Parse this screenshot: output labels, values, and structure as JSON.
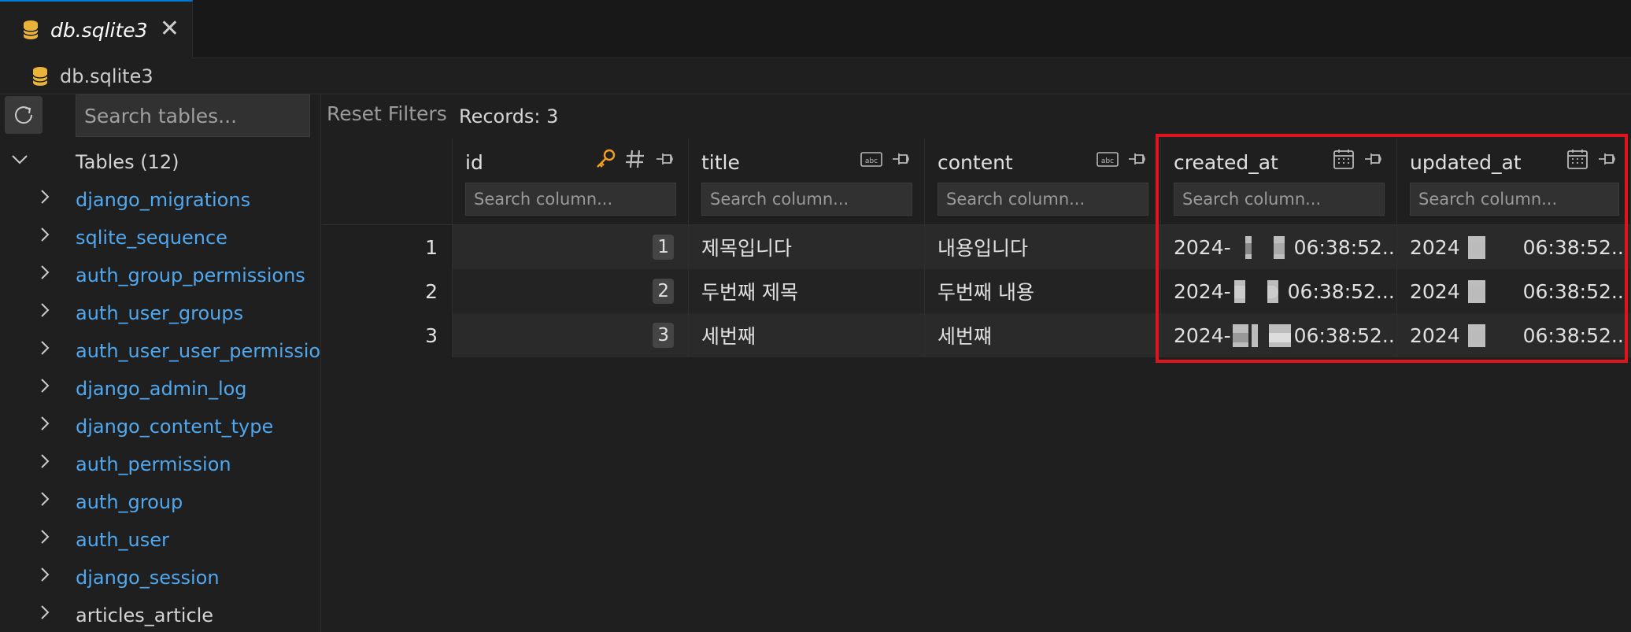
{
  "tab": {
    "title": "db.sqlite3",
    "close_glyph": "✕"
  },
  "breadcrumb": {
    "label": "db.sqlite3"
  },
  "sidebar": {
    "search_placeholder": "Search tables...",
    "tables_header": "Tables (12)",
    "tables": [
      "django_migrations",
      "sqlite_sequence",
      "auth_group_permissions",
      "auth_user_groups",
      "auth_user_user_permissions",
      "django_admin_log",
      "django_content_type",
      "auth_permission",
      "auth_group",
      "auth_user",
      "django_session",
      "articles_article"
    ]
  },
  "toolbar": {
    "reset_label": "Reset Filters",
    "records_label": "Records: 3"
  },
  "columns": [
    {
      "name": "id",
      "placeholder": "Search column..."
    },
    {
      "name": "title",
      "placeholder": "Search column..."
    },
    {
      "name": "content",
      "placeholder": "Search column..."
    },
    {
      "name": "created_at",
      "placeholder": "Search column..."
    },
    {
      "name": "updated_at",
      "placeholder": "Search column..."
    }
  ],
  "rows": [
    {
      "num": "1",
      "id": "1",
      "title": "제목입니다",
      "content": "내용입니다",
      "created_at": "2024-",
      "created_time": "06:38:52....",
      "updated_at": "2024",
      "updated_time": "06:38:52...."
    },
    {
      "num": "2",
      "id": "2",
      "title": "두번째 제목",
      "content": "두번째 내용",
      "created_at": "2024-",
      "created_time": "06:38:52....",
      "updated_at": "2024",
      "updated_time": "06:38:52...."
    },
    {
      "num": "3",
      "id": "3",
      "title": "세번째",
      "content": "세번쨰",
      "created_at": "2024-",
      "created_time": "06:38:52....",
      "updated_at": "2024",
      "updated_time": "06:38:52...."
    }
  ],
  "colors": {
    "accent": "#0078d4",
    "link": "#4fa8f0",
    "highlight": "#e0141c",
    "key_icon": "#f0a020"
  }
}
